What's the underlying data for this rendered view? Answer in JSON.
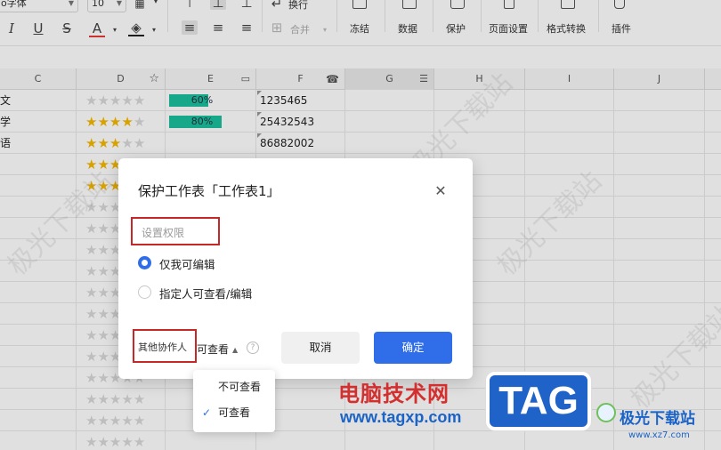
{
  "toolbar": {
    "font_name": "o字体",
    "font_size": "10",
    "wrap_label": "换行",
    "merge_label": "合并",
    "groups": [
      {
        "label": "冻结"
      },
      {
        "label": "数据"
      },
      {
        "label": "保护"
      },
      {
        "label": "页面设置"
      },
      {
        "label": "格式转换"
      },
      {
        "label": "插件"
      }
    ]
  },
  "columns": [
    "C",
    "D",
    "E",
    "F",
    "G",
    "H",
    "I",
    "J"
  ],
  "rows": [
    {
      "c": "文",
      "stars": 0,
      "bar": "60%",
      "bar_fill": 0.6,
      "f": "1235465"
    },
    {
      "c": "学",
      "stars": 4,
      "bar": "80%",
      "bar_fill": 0.8,
      "f": "25432543"
    },
    {
      "c": "语",
      "stars": 3,
      "bar": "",
      "bar_fill": 0,
      "f": "86882002"
    },
    {
      "c": "",
      "stars": 3,
      "bar": "",
      "bar_fill": 0,
      "f": ""
    },
    {
      "c": "",
      "stars": 3,
      "bar": "",
      "bar_fill": 0,
      "f": ""
    },
    {
      "c": "",
      "stars": 0,
      "bar": "",
      "bar_fill": 0,
      "f": ""
    },
    {
      "c": "",
      "stars": 0,
      "bar": "",
      "bar_fill": 0,
      "f": ""
    },
    {
      "c": "",
      "stars": 0,
      "bar": "",
      "bar_fill": 0,
      "f": ""
    },
    {
      "c": "",
      "stars": 0,
      "bar": "",
      "bar_fill": 0,
      "f": ""
    },
    {
      "c": "",
      "stars": 0,
      "bar": "",
      "bar_fill": 0,
      "f": ""
    },
    {
      "c": "",
      "stars": 0,
      "bar": "",
      "bar_fill": 0,
      "f": ""
    },
    {
      "c": "",
      "stars": 0,
      "bar": "",
      "bar_fill": 0,
      "f": ""
    },
    {
      "c": "",
      "stars": 0,
      "bar": "",
      "bar_fill": 0,
      "f": ""
    },
    {
      "c": "",
      "stars": 0,
      "bar": "",
      "bar_fill": 0,
      "f": ""
    },
    {
      "c": "",
      "stars": 0,
      "bar": "",
      "bar_fill": 0,
      "f": ""
    },
    {
      "c": "",
      "stars": 0,
      "bar": "",
      "bar_fill": 0,
      "f": ""
    },
    {
      "c": "",
      "stars": 0,
      "bar": "",
      "bar_fill": 0,
      "f": ""
    }
  ],
  "dialog": {
    "title": "保护工作表「工作表1」",
    "permission_placeholder": "设置权限",
    "options": [
      {
        "label": "仅我可编辑",
        "selected": true
      },
      {
        "label": "指定人可查看/编辑",
        "selected": false
      }
    ],
    "collaborators_label": "其他协作人",
    "collaborators_value": "可查看",
    "cancel_label": "取消",
    "ok_label": "确定"
  },
  "dropdown": {
    "options": [
      {
        "label": "不可查看",
        "checked": false
      },
      {
        "label": "可查看",
        "checked": true
      }
    ]
  },
  "watermark": {
    "site_name": "电脑技术网",
    "site_url": "www.tagxp.com",
    "tag": "TAG",
    "brand": "极光下载站",
    "brand_url": "www.xz7.com",
    "faint": "极光下载站"
  },
  "colors": {
    "accent": "#2f6ee8",
    "bar": "#1bc09c",
    "star": "#f5b800",
    "highlight_box": "#c62828"
  }
}
